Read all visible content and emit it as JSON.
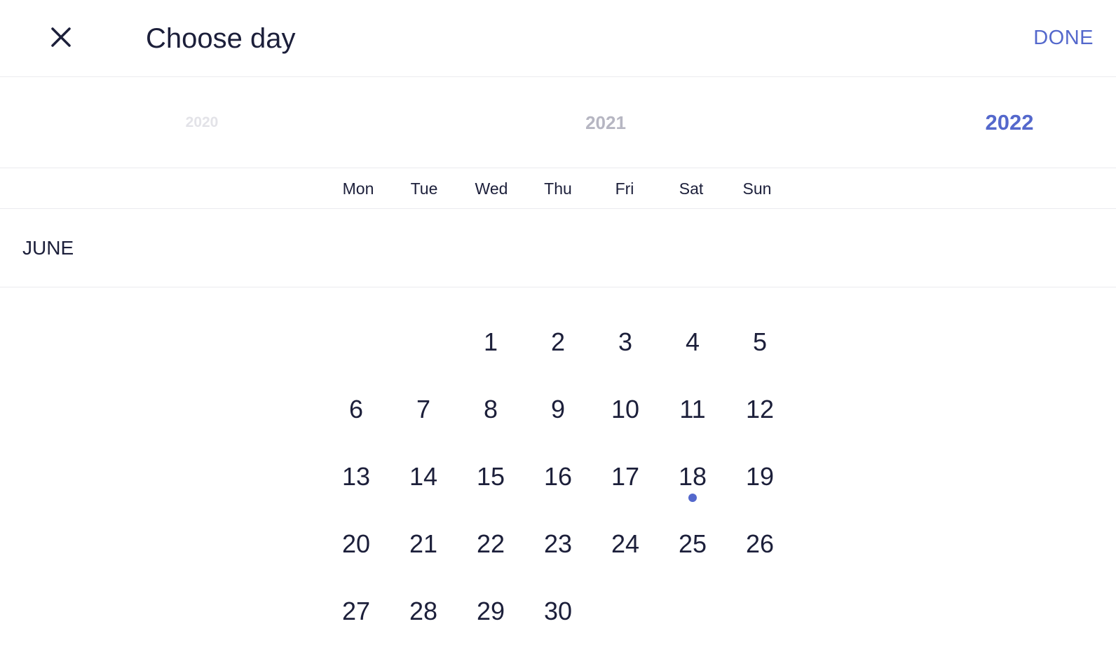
{
  "header": {
    "title": "Choose day",
    "done_label": "DONE"
  },
  "colors": {
    "accent": "#5468cc",
    "text": "#1c1f3a",
    "year_faint": "#e3e3e8",
    "year_muted": "#b6b6c2",
    "divider": "#ebebef"
  },
  "icons": {
    "close": "close-icon"
  },
  "years": [
    {
      "label": "2020"
    },
    {
      "label": "2021"
    },
    {
      "label": "2022",
      "selected": true
    }
  ],
  "weekdays": [
    "Mon",
    "Tue",
    "Wed",
    "Thu",
    "Fri",
    "Sat",
    "Sun"
  ],
  "month": {
    "label": "JUNE",
    "first_weekday_index": 2,
    "days": [
      "1",
      "2",
      "3",
      "4",
      "5",
      "6",
      "7",
      "8",
      "9",
      "10",
      "11",
      "12",
      "13",
      "14",
      "15",
      "16",
      "17",
      "18",
      "19",
      "20",
      "21",
      "22",
      "23",
      "24",
      "25",
      "26",
      "27",
      "28",
      "29",
      "30"
    ],
    "marked_day": "18"
  }
}
